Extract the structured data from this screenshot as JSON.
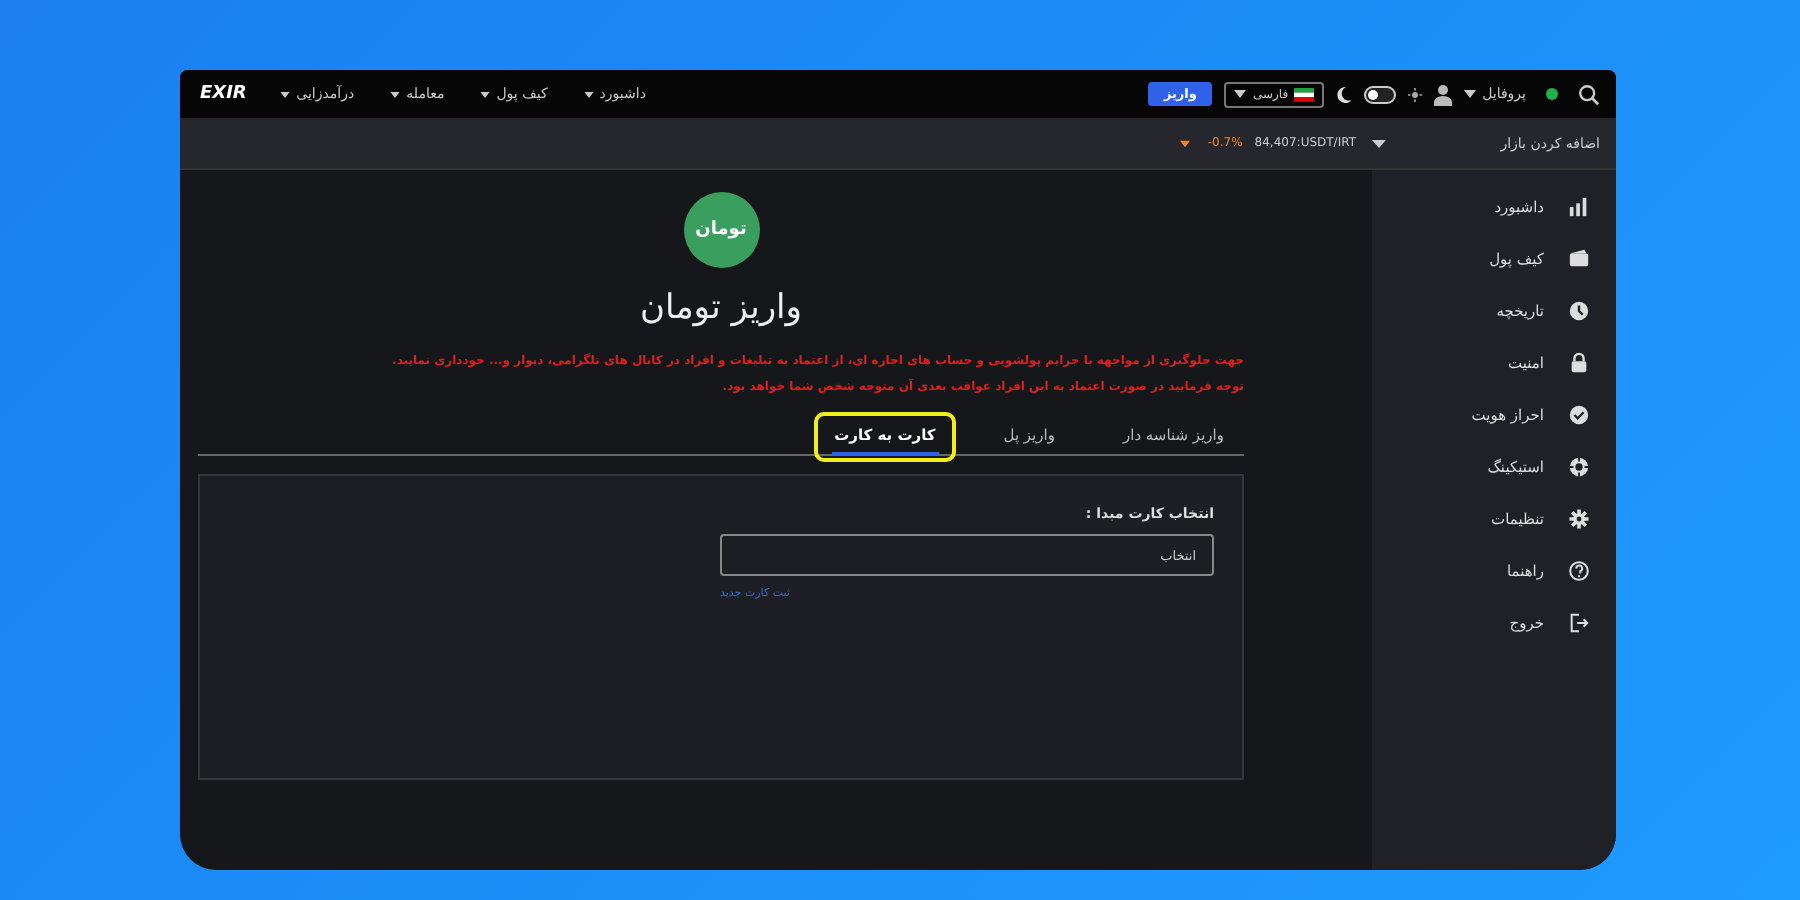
{
  "top_bar": {
    "logo": "EXIR",
    "menus": [
      {
        "label": "داشبورد"
      },
      {
        "label": "کیف پول"
      },
      {
        "label": "معامله"
      },
      {
        "label": "درآمدزایی"
      }
    ],
    "profile": "پروفایل",
    "online": true,
    "theme_toggle": {
      "on": false
    },
    "language": "فارسی",
    "deposit_button": "واریز"
  },
  "market_bar": {
    "add_market": "اضافه کردن بازار",
    "pair": "84,407:USDT/IRT",
    "change": "-0.7%",
    "falling": true
  },
  "sidebar": {
    "items": [
      {
        "label": "داشبورد"
      },
      {
        "label": "کیف پول"
      },
      {
        "label": "تاریخچه"
      },
      {
        "label": "امنیت"
      },
      {
        "label": "احراز هویت"
      },
      {
        "label": "استیکینگ"
      },
      {
        "label": "تنظیمات"
      },
      {
        "label": "راهنما"
      },
      {
        "label": "خروج"
      }
    ]
  },
  "deposit": {
    "coin_badge": "تومان",
    "title": "واریز تومان",
    "warnings": [
      "جهت جلوگیری از مواجهه با جرایم پولشویی و حساب های اجاره ای، از اعتماد به تبلیغات و افراد در کانال های تلگرامی، دیوار و... خودداری نمایید.",
      "توجه فرمایید در صورت اعتماد به این افراد عواقب بعدی آن متوجه شخص شما خواهد بود."
    ],
    "tabs": [
      {
        "label": "واریز شناسه دار",
        "selected": false,
        "highlighted": false
      },
      {
        "label": "واریز پل",
        "selected": false,
        "highlighted": false
      },
      {
        "label": "کارت به کارت",
        "selected": true,
        "highlighted": true
      }
    ],
    "card_label": "انتخاب کارت مبدا :",
    "card_select": {
      "value": "انتخاب"
    },
    "new_card_link": "ثبت کارت جدید"
  }
}
